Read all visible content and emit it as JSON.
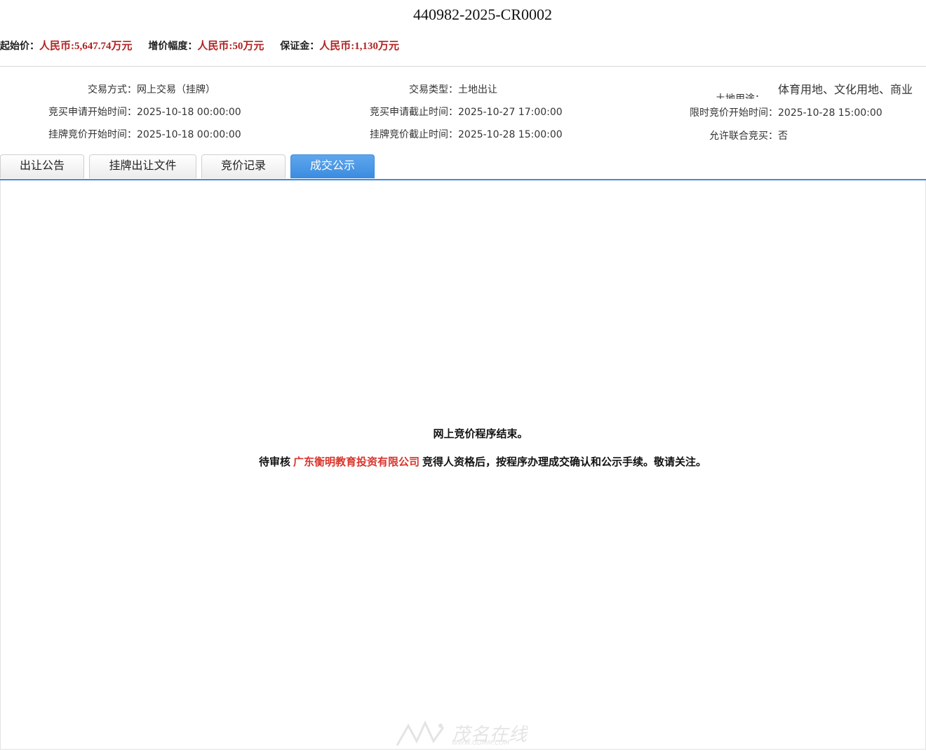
{
  "header": {
    "title": "440982-2025-CR0002"
  },
  "prices": {
    "start_label": "起始价：",
    "start_value": "人民币:5,647.74万元",
    "increment_label": "增价幅度：",
    "increment_value": "人民币:50万元",
    "deposit_label": "保证金：",
    "deposit_value": "人民币:1,130万元"
  },
  "info": {
    "trade_method_label": "交易方式：",
    "trade_method_value": "网上交易（挂牌）",
    "trade_type_label": "交易类型：",
    "trade_type_value": "土地出让",
    "land_use_label": "土地用途：",
    "land_use_value": "体育用地、文化用地、商业",
    "apply_start_label": "竞买申请开始时间：",
    "apply_start_value": "2025-10-18 00:00:00",
    "apply_end_label": "竞买申请截止时间：",
    "apply_end_value": "2025-10-27 17:00:00",
    "timed_bid_start_label": "限时竞价开始时间：",
    "timed_bid_start_value": "2025-10-28 15:00:00",
    "listing_start_label": "挂牌竞价开始时间：",
    "listing_start_value": "2025-10-18 00:00:00",
    "listing_end_label": "挂牌竞价截止时间：",
    "listing_end_value": "2025-10-28 15:00:00",
    "joint_bid_label": "允许联合竞买：",
    "joint_bid_value": "否"
  },
  "tabs": [
    {
      "label": "出让公告",
      "active": false
    },
    {
      "label": "挂牌出让文件",
      "active": false
    },
    {
      "label": "竞价记录",
      "active": false
    },
    {
      "label": "成交公示",
      "active": true
    }
  ],
  "content": {
    "line1": "网上竞价程序结束。",
    "line2_prefix": "待审核",
    "company": "广东衡明教育投资有限公司",
    "line2_suffix": "竞得人资格后，按程序办理成交确认和公示手续。敬请关注。"
  },
  "watermark": {
    "text": "茂名在线",
    "url": "WWW.GDMM.COM"
  },
  "colors": {
    "accent": "#3a8be0",
    "price_red": "#b22222",
    "company_red": "#d9342b"
  }
}
